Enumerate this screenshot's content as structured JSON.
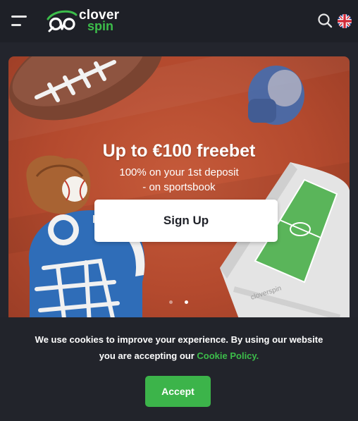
{
  "header": {
    "logo": {
      "word1": "clover",
      "word2": "spin"
    },
    "icons": {
      "menu": "hamburger-menu-icon",
      "search": "search-icon",
      "language": "uk-flag-icon"
    }
  },
  "banner": {
    "title": "Up to €100 freebet",
    "subtitle_line1": "100% on your 1st deposit",
    "subtitle_line2": "- on sportsbook",
    "button_label": "Sign Up",
    "slides": 2,
    "active_slide": 2
  },
  "cookie": {
    "text_part1": "We use cookies to improve your experience. By using our website you are accepting our ",
    "link_text": "Cookie Policy.",
    "accept_label": "Accept"
  },
  "colors": {
    "brand_green": "#3cbd4a",
    "header_bg": "#1e2027",
    "banner_bg": "#b44a2e"
  }
}
